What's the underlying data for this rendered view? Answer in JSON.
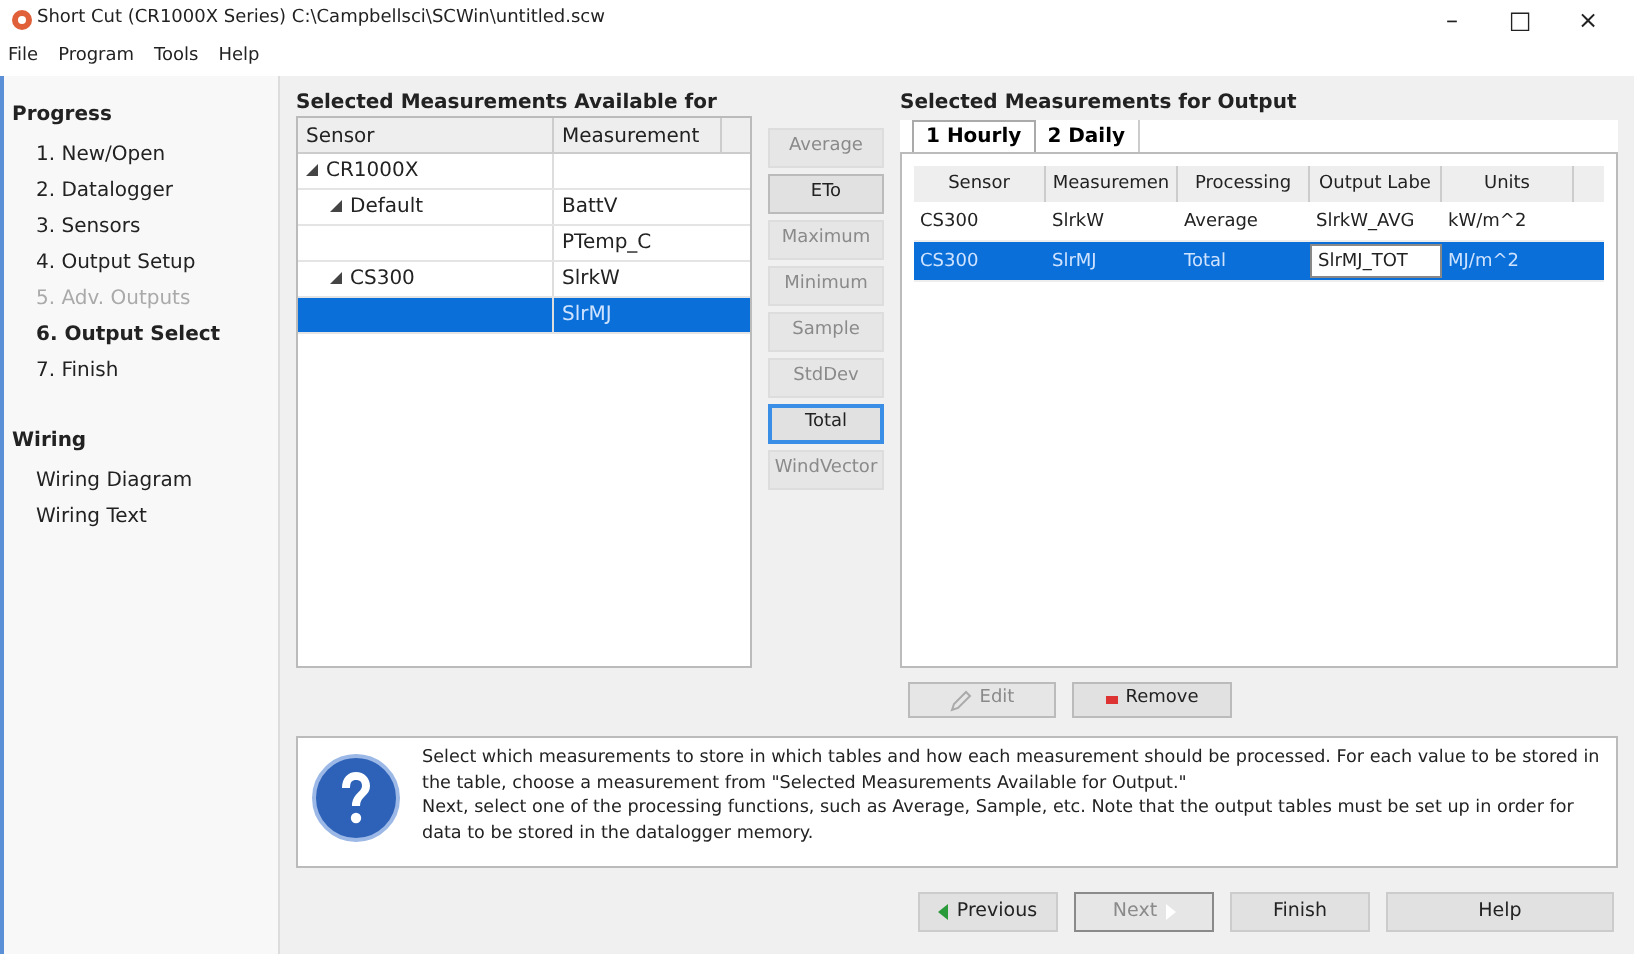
{
  "window": {
    "title": "Short Cut (CR1000X Series) C:\\Campbellsci\\SCWin\\untitled.scw",
    "controls": [
      "–",
      "□",
      "×"
    ]
  },
  "menu": [
    "File",
    "Program",
    "Tools",
    "Help"
  ],
  "sidebar": {
    "sections": [
      {
        "heading": "Progress",
        "items": [
          {
            "label": "1. New/Open",
            "current": false,
            "disabled": false
          },
          {
            "label": "2. Datalogger",
            "current": false,
            "disabled": false
          },
          {
            "label": "3. Sensors",
            "current": false,
            "disabled": false
          },
          {
            "label": "4. Output Setup",
            "current": false,
            "disabled": false
          },
          {
            "label": "5. Adv. Outputs",
            "current": false,
            "disabled": true
          },
          {
            "label": "6. Output Select",
            "current": true,
            "disabled": false
          },
          {
            "label": "7. Finish",
            "current": false,
            "disabled": false
          }
        ]
      },
      {
        "heading": "Wiring",
        "items": [
          {
            "label": "Wiring Diagram",
            "current": false,
            "disabled": false
          },
          {
            "label": "Wiring Text",
            "current": false,
            "disabled": false
          }
        ]
      }
    ]
  },
  "available": {
    "title": "Selected Measurements Available for",
    "columns": [
      "Sensor",
      "Measurement"
    ],
    "tree": [
      {
        "label": "CR1000X",
        "expanded": true,
        "children": [
          {
            "label": "Default",
            "expanded": true,
            "measurements": [
              {
                "name": "BattV",
                "selected": false
              },
              {
                "name": "PTemp_C",
                "selected": false
              }
            ]
          },
          {
            "label": "CS300",
            "expanded": true,
            "measurements": [
              {
                "name": "SlrkW",
                "selected": false
              },
              {
                "name": "SlrMJ",
                "selected": true
              }
            ]
          }
        ]
      }
    ]
  },
  "processing_buttons": [
    {
      "label": "Average",
      "disabled": true,
      "focused": false
    },
    {
      "label": "ETo",
      "disabled": false,
      "focused": false
    },
    {
      "label": "Maximum",
      "disabled": true,
      "focused": false
    },
    {
      "label": "Minimum",
      "disabled": true,
      "focused": false
    },
    {
      "label": "Sample",
      "disabled": true,
      "focused": false
    },
    {
      "label": "StdDev",
      "disabled": true,
      "focused": false
    },
    {
      "label": "Total",
      "disabled": false,
      "focused": true
    },
    {
      "label": "WindVector",
      "disabled": true,
      "focused": false
    }
  ],
  "output": {
    "title": "Selected Measurements for Output",
    "tabs": [
      {
        "label": "1 Hourly",
        "selected": true
      },
      {
        "label": "2 Daily",
        "selected": false
      }
    ],
    "columns": [
      "Sensor",
      "Measuremen",
      "Processing",
      "Output Labe",
      "Units"
    ],
    "rows": [
      {
        "cells": [
          "CS300",
          "SlrkW",
          "Average",
          "SlrkW_AVG",
          "kW/m^2"
        ],
        "selected": false,
        "editing": false
      },
      {
        "cells": [
          "CS300",
          "SlrMJ",
          "Total",
          "SlrMJ_TOT",
          "MJ/m^2"
        ],
        "selected": true,
        "editing": true
      }
    ],
    "actions": [
      {
        "label": "Edit",
        "kind": "edit",
        "disabled": true
      },
      {
        "label": "Remove",
        "kind": "remove",
        "disabled": false
      }
    ]
  },
  "info": {
    "text": "Select which measurements to store in which tables and how each measurement should be processed. For each value to be stored in the table, choose a measurement from \"Selected Measurements Available for Output.\"\nNext, select one of the processing functions, such as Average, Sample, etc. Note that the output tables must be set up in order for data to be stored in the datalogger memory."
  },
  "nav_buttons": [
    {
      "label": "Previous",
      "kind": "previous",
      "disabled": false
    },
    {
      "label": "Next",
      "kind": "next",
      "disabled": true
    },
    {
      "label": "Finish",
      "kind": "plain",
      "disabled": false
    },
    {
      "label": "Help",
      "kind": "plain",
      "disabled": false
    }
  ]
}
